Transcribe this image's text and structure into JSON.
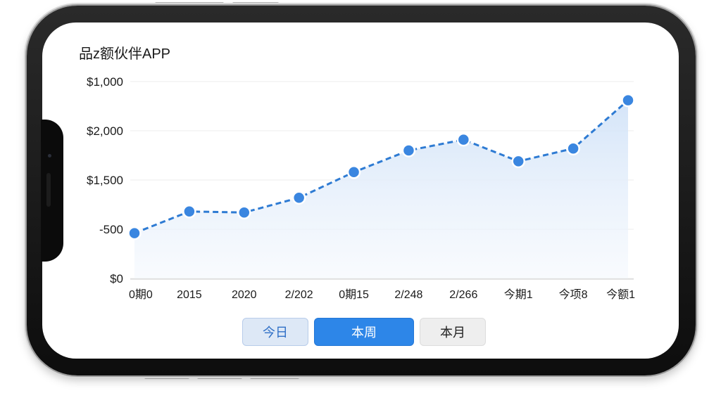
{
  "app": {
    "title": "品z额伙伴APP"
  },
  "tabs": [
    {
      "label": "今日",
      "active": false
    },
    {
      "label": "本周",
      "active": true
    },
    {
      "label": "本月",
      "active": false
    }
  ],
  "colors": {
    "line": "#2e7bd3",
    "point": "#3a86e0",
    "area_top": "#d2e3f8",
    "grid": "#ececec",
    "active_tab": "#2d86e8"
  },
  "chart_data": {
    "type": "line",
    "title": "",
    "xlabel": "",
    "ylabel": "",
    "categories": [
      "0期0",
      "2015",
      "2020",
      "2/202",
      "0期15",
      "2/248",
      "2/266",
      "今期1",
      "今项8",
      "今额1"
    ],
    "y_tick_labels": [
      "$0",
      "-500",
      "$1,500",
      "$2,000",
      "$1,000"
    ],
    "ylim": [
      0,
      2000
    ],
    "series": [
      {
        "values": [
          460,
          680,
          670,
          820,
          1080,
          1300,
          1410,
          1190,
          1320,
          1810
        ]
      }
    ],
    "grid": true,
    "line_style": "dashed",
    "area_fill": true,
    "legend": "none"
  }
}
